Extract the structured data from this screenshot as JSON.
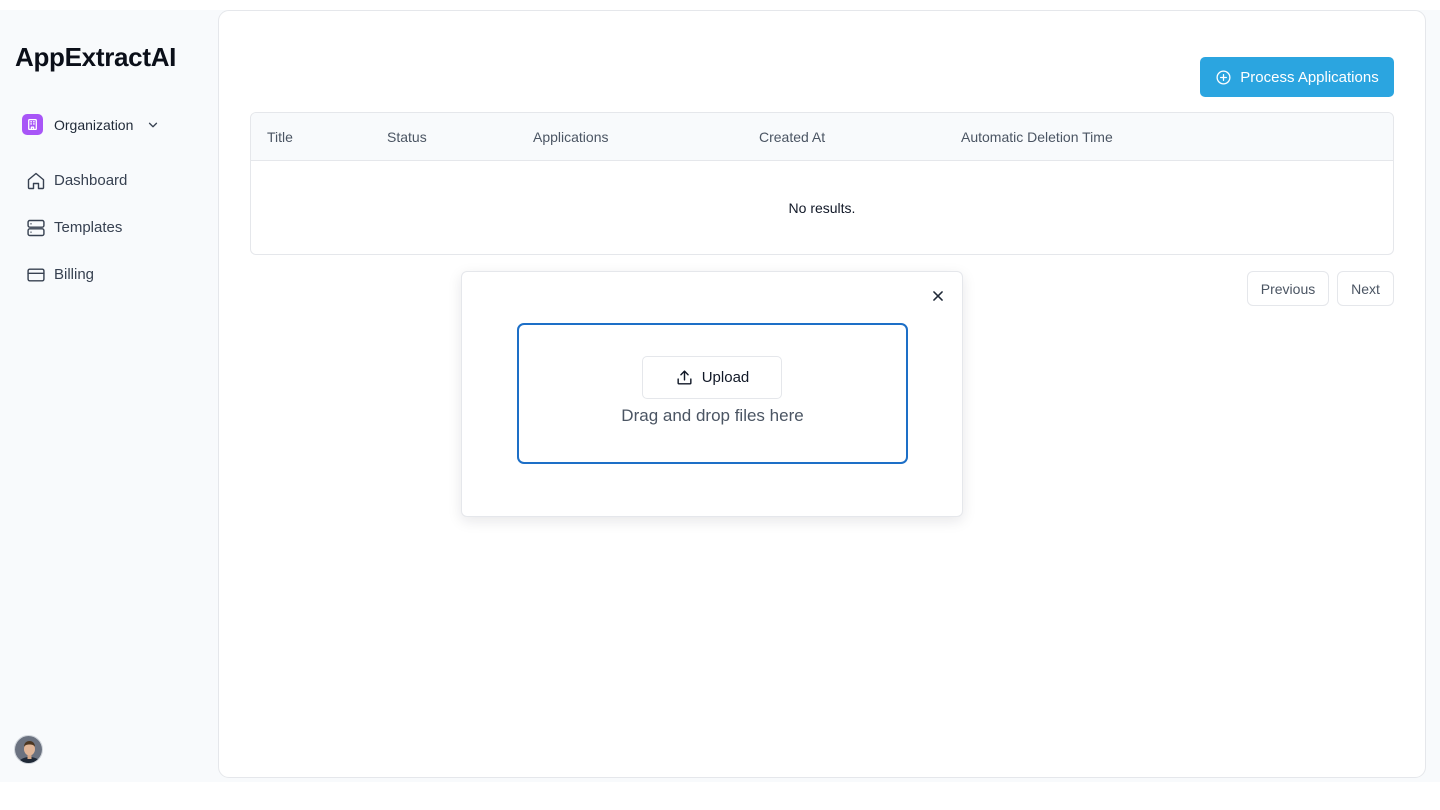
{
  "sidebar": {
    "brand": "AppExtractAI",
    "org_label": "Organization",
    "org_icon": "building-icon",
    "items": [
      {
        "label": "Dashboard",
        "icon": "home-icon"
      },
      {
        "label": "Templates",
        "icon": "server-icon"
      },
      {
        "label": "Billing",
        "icon": "credit-card-icon"
      }
    ]
  },
  "header": {
    "process_label": "Process Applications",
    "process_icon": "plus-circle-icon"
  },
  "table": {
    "columns": [
      "Title",
      "Status",
      "Applications",
      "Created At",
      "Automatic Deletion Time"
    ],
    "empty_text": "No results."
  },
  "pagination": {
    "previous_label": "Previous",
    "next_label": "Next"
  },
  "modal": {
    "upload_label": "Upload",
    "drop_text": "Drag and drop files here",
    "close_icon": "close-icon"
  },
  "colors": {
    "accent": "#2ba5e0",
    "dropzone_border": "#1d6fc7",
    "org_badge": "#a855f7"
  }
}
